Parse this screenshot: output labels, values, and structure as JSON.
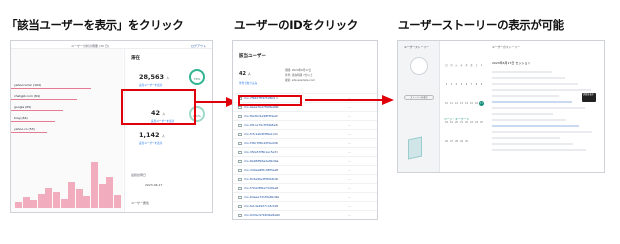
{
  "captions": {
    "step1": "「該当ユーザーを表示」をクリック",
    "step2": "ユーザーのIDをクリック",
    "step3": "ユーザーストーリーの表示が可能"
  },
  "panel1": {
    "logout": "ログアウト",
    "header_text": "ユーザー分析の概要 (30 日)",
    "users": [
      {
        "label": "yahoocomic (104)"
      },
      {
        "label": "chatgpt.com (84)"
      },
      {
        "label": "google (65)"
      },
      {
        "label": "bing (64)"
      },
      {
        "label": "yahoo.co (53)"
      }
    ],
    "bars": [
      0.12,
      0.22,
      0.16,
      0.3,
      0.42,
      0.34,
      0.18,
      0.55,
      0.4,
      0.26,
      0.95,
      0.5,
      0.64,
      0.28
    ],
    "title": "滞在",
    "stat1": {
      "value": "28,563",
      "unit": "人",
      "link": "該当ユーザーを表示",
      "ring": "76%"
    },
    "stat2": {
      "value": "42",
      "unit": "人",
      "link": "該当ユーザーを表示",
      "ring": "0.1%"
    },
    "stat3": {
      "value": "1,142",
      "unit": "人",
      "link": "該当ユーザーを表示"
    },
    "date_label": "最終訪問日",
    "date": "2023-06-17",
    "segment": "ユーザー属性"
  },
  "panel2": {
    "title": "該当ユーザー",
    "count": "42",
    "count_unit": "人",
    "count_link": "条件で絞り込み",
    "meta": [
      "期間: 2023年6月17日",
      "条件: 滞在時間 7分以上",
      "検索: site:example.com"
    ],
    "ids": [
      "mo-7f6b7f3f1f7e8b9",
      "mo-9eaa7bd7f99fe9b0",
      "mo-f6ef4d1a98f3f4e2",
      "mo-0f1ca79cf4fdb8a3",
      "mo-f1fc1ab9f3f6e1c0",
      "mo-f38c7f6b4df3e4d1",
      "mo-3f2a57f8b1ec5a7",
      "mo-8e96ff96a2e8bd1e",
      "mo-3d4ae8f6c98f3ee5",
      "mo-8c6a9fe4f9f0b6d2",
      "mo-f70dc8f6a7dd4be3",
      "mo-6deee7d1f0a8bd2e",
      "mo-fe1de29d7ca5cfa3",
      "mo-9d3ac97b8d4e8ad0",
      "mo-3a5f4d8b4c96f0b7"
    ]
  },
  "panel3": {
    "side_header": "ユーザーストーリー",
    "pill": "ストーリーを表示",
    "tag": "ページ・キーワード",
    "main_header": "ユーザーのストーリー",
    "timeline": "2023年6月17日 セッション",
    "tooltip": "詳細を表示",
    "calendar": [
      "日",
      "月",
      "火",
      "水",
      "木",
      "金",
      "土",
      "1",
      "2",
      "3",
      "4",
      "5",
      "6",
      "7",
      "8",
      "9",
      "10",
      "11",
      "12",
      "13",
      "14",
      "15",
      "16",
      "17",
      "18",
      "19",
      "20",
      "21",
      "22",
      "23",
      "24",
      "25",
      "26",
      "27",
      "28",
      "29",
      "30"
    ],
    "selected_day": "17"
  },
  "colors": {
    "highlight_red": "#e0000b",
    "accent_teal": "#0f8f7a",
    "chart_pink": "#f1adbe",
    "link_blue": "#1a73e8"
  }
}
